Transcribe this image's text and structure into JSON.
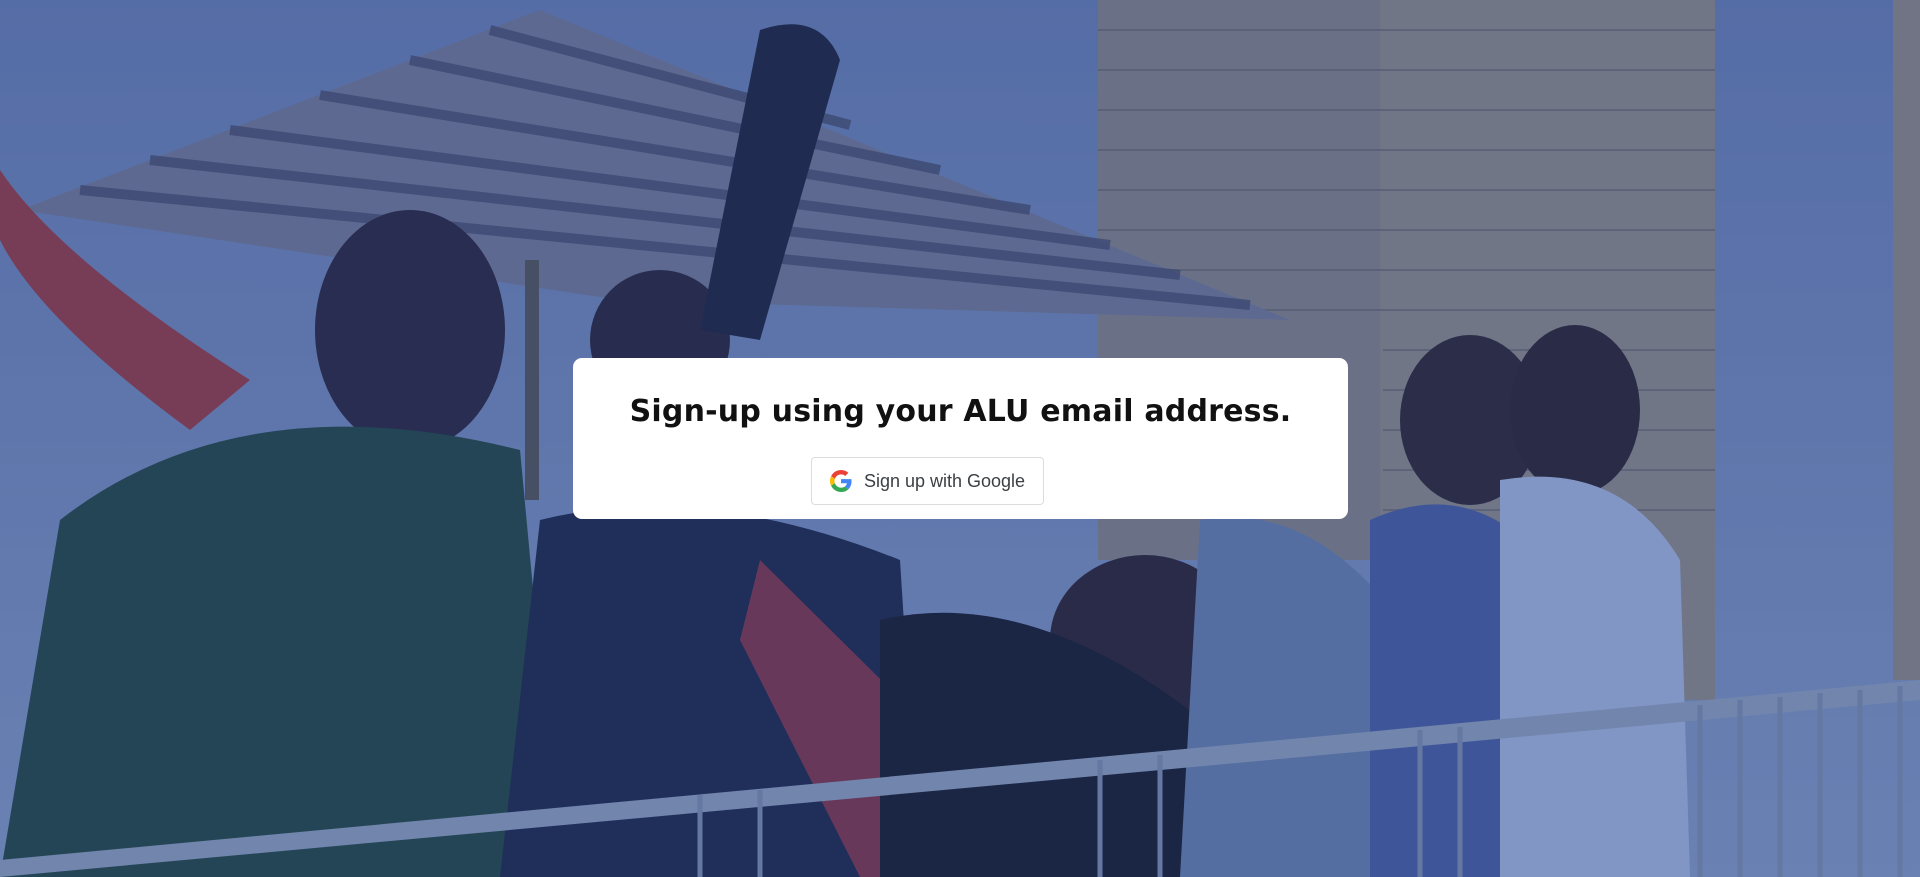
{
  "page": {
    "background": "photo-of-students-leaning-on-railing",
    "overlay_color": "#26428c"
  },
  "signup": {
    "title": "Sign-up using your ALU email address.",
    "google_button_label": "Sign up with Google",
    "google_icon": "google-g-icon"
  }
}
